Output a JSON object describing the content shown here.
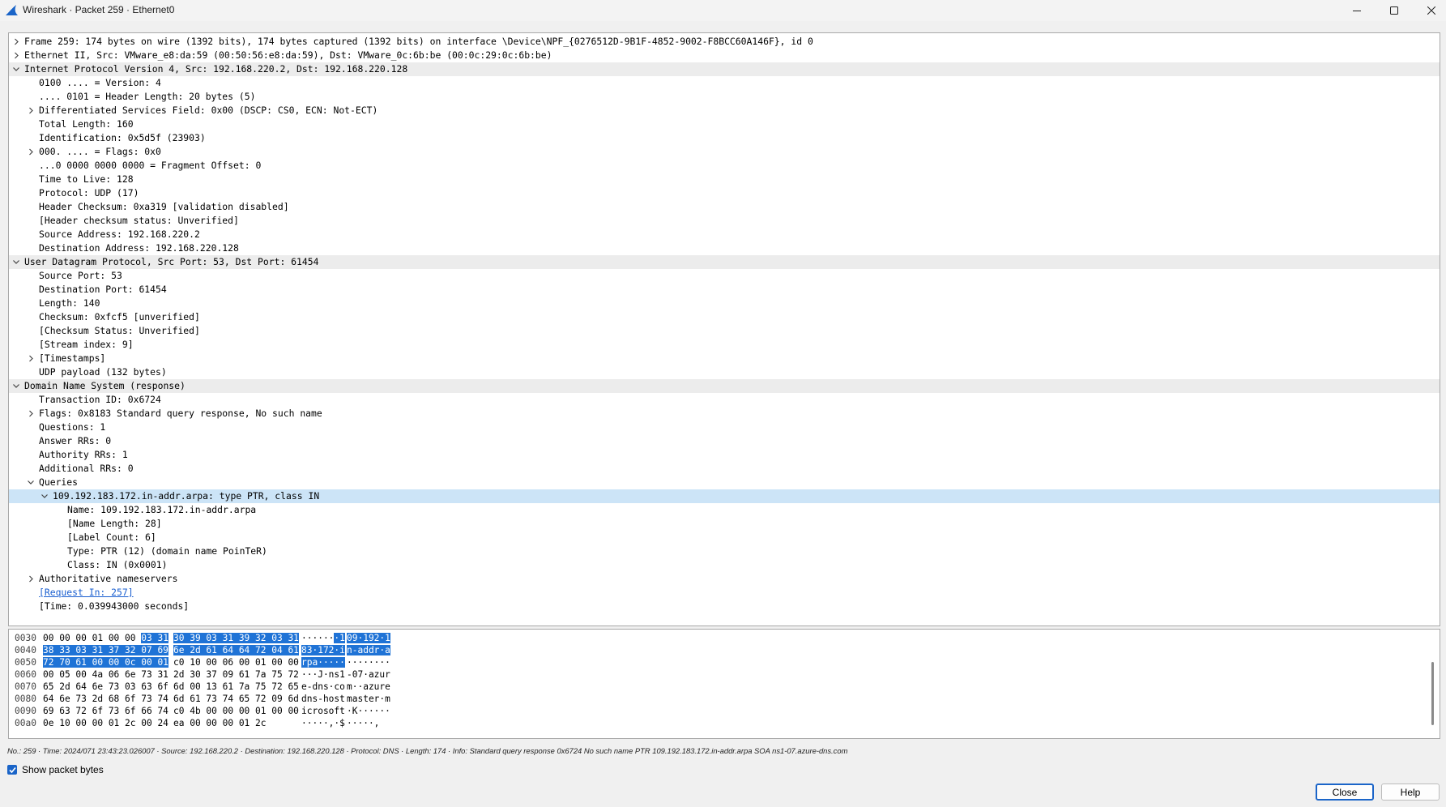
{
  "window": {
    "title": "Wireshark · Packet 259 · Ethernet0",
    "icon": "wireshark-fin-icon",
    "controls": [
      "minimize-icon",
      "maximize-icon",
      "close-icon"
    ]
  },
  "tree": [
    {
      "text": "Frame 259: 174 bytes on wire (1392 bits), 174 bytes captured (1392 bits) on interface \\Device\\NPF_{0276512D-9B1F-4852-9002-F8BCC60A146F}, id 0",
      "level": 0,
      "toggle": "collapsed"
    },
    {
      "text": "Ethernet II, Src: VMware_e8:da:59 (00:50:56:e8:da:59), Dst: VMware_0c:6b:be (00:0c:29:0c:6b:be)",
      "level": 0,
      "toggle": "collapsed"
    },
    {
      "text": "Internet Protocol Version 4, Src: 192.168.220.2, Dst: 192.168.220.128",
      "level": 0,
      "toggle": "expanded",
      "highlight": "gray"
    },
    {
      "text": "0100 .... = Version: 4",
      "level": 1
    },
    {
      "text": ".... 0101 = Header Length: 20 bytes (5)",
      "level": 1
    },
    {
      "text": "Differentiated Services Field: 0x00 (DSCP: CS0, ECN: Not-ECT)",
      "level": 1,
      "toggle": "collapsed"
    },
    {
      "text": "Total Length: 160",
      "level": 1
    },
    {
      "text": "Identification: 0x5d5f (23903)",
      "level": 1
    },
    {
      "text": "000. .... = Flags: 0x0",
      "level": 1,
      "toggle": "collapsed"
    },
    {
      "text": "...0 0000 0000 0000 = Fragment Offset: 0",
      "level": 1
    },
    {
      "text": "Time to Live: 128",
      "level": 1
    },
    {
      "text": "Protocol: UDP (17)",
      "level": 1
    },
    {
      "text": "Header Checksum: 0xa319 [validation disabled]",
      "level": 1
    },
    {
      "text": "[Header checksum status: Unverified]",
      "level": 1
    },
    {
      "text": "Source Address: 192.168.220.2",
      "level": 1
    },
    {
      "text": "Destination Address: 192.168.220.128",
      "level": 1
    },
    {
      "text": "User Datagram Protocol, Src Port: 53, Dst Port: 61454",
      "level": 0,
      "toggle": "expanded",
      "highlight": "gray"
    },
    {
      "text": "Source Port: 53",
      "level": 1
    },
    {
      "text": "Destination Port: 61454",
      "level": 1
    },
    {
      "text": "Length: 140",
      "level": 1
    },
    {
      "text": "Checksum: 0xfcf5 [unverified]",
      "level": 1
    },
    {
      "text": "[Checksum Status: Unverified]",
      "level": 1
    },
    {
      "text": "[Stream index: 9]",
      "level": 1
    },
    {
      "text": "[Timestamps]",
      "level": 1,
      "toggle": "collapsed"
    },
    {
      "text": "UDP payload (132 bytes)",
      "level": 1
    },
    {
      "text": "Domain Name System (response)",
      "level": 0,
      "toggle": "expanded",
      "highlight": "gray"
    },
    {
      "text": "Transaction ID: 0x6724",
      "level": 1
    },
    {
      "text": "Flags: 0x8183 Standard query response, No such name",
      "level": 1,
      "toggle": "collapsed"
    },
    {
      "text": "Questions: 1",
      "level": 1
    },
    {
      "text": "Answer RRs: 0",
      "level": 1
    },
    {
      "text": "Authority RRs: 1",
      "level": 1
    },
    {
      "text": "Additional RRs: 0",
      "level": 1
    },
    {
      "text": "Queries",
      "level": 1,
      "toggle": "expanded"
    },
    {
      "text": "109.192.183.172.in-addr.arpa: type PTR, class IN",
      "level": 2,
      "toggle": "expanded",
      "highlight": "blue"
    },
    {
      "text": "Name: 109.192.183.172.in-addr.arpa",
      "level": 3
    },
    {
      "text": "[Name Length: 28]",
      "level": 3
    },
    {
      "text": "[Label Count: 6]",
      "level": 3
    },
    {
      "text": "Type: PTR (12) (domain name PoinTeR)",
      "level": 3
    },
    {
      "text": "Class: IN (0x0001)",
      "level": 3
    },
    {
      "text": "Authoritative nameservers",
      "level": 1,
      "toggle": "collapsed"
    },
    {
      "text": "[Request In: 257]",
      "level": 1,
      "link": true
    },
    {
      "text": "[Time: 0.039943000 seconds]",
      "level": 1
    }
  ],
  "bytes": [
    {
      "offset": "0030",
      "hex1": [
        {
          "t": "00 00 00 01 00 00 ",
          "s": false
        },
        {
          "t": "03 31",
          "s": true
        }
      ],
      "hex2": [
        {
          "t": "30 39 03 31 39 32 03 31",
          "s": true
        }
      ],
      "ascii1": [
        {
          "t": "······",
          "s": false
        },
        {
          "t": "·1",
          "s": true
        }
      ],
      "ascii2": [
        {
          "t": "09·192·1",
          "s": true
        }
      ]
    },
    {
      "offset": "0040",
      "hex1": [
        {
          "t": "38 33 03 31 37 32 07 69",
          "s": true
        }
      ],
      "hex2": [
        {
          "t": "6e 2d 61 64 64 72 04 61",
          "s": true
        }
      ],
      "ascii1": [
        {
          "t": "83·172·i",
          "s": true
        }
      ],
      "ascii2": [
        {
          "t": "n-addr·a",
          "s": true
        }
      ]
    },
    {
      "offset": "0050",
      "hex1": [
        {
          "t": "72 70 61 00 00 0c 00 01",
          "s": true
        }
      ],
      "hex2": [
        {
          "t": "c0 10 00 06 00 01 00 00",
          "s": false
        }
      ],
      "ascii1": [
        {
          "t": "rpa·····",
          "s": true
        }
      ],
      "ascii2": [
        {
          "t": "········",
          "s": false
        }
      ]
    },
    {
      "offset": "0060",
      "hex1": [
        {
          "t": "00 05 00 4a 06 6e 73 31",
          "s": false
        }
      ],
      "hex2": [
        {
          "t": "2d 30 37 09 61 7a 75 72",
          "s": false
        }
      ],
      "ascii1": [
        {
          "t": "···J·ns1",
          "s": false
        }
      ],
      "ascii2": [
        {
          "t": "-07·azur",
          "s": false
        }
      ]
    },
    {
      "offset": "0070",
      "hex1": [
        {
          "t": "65 2d 64 6e 73 03 63 6f",
          "s": false
        }
      ],
      "hex2": [
        {
          "t": "6d 00 13 61 7a 75 72 65",
          "s": false
        }
      ],
      "ascii1": [
        {
          "t": "e-dns·co",
          "s": false
        }
      ],
      "ascii2": [
        {
          "t": "m··azure",
          "s": false
        }
      ]
    },
    {
      "offset": "0080",
      "hex1": [
        {
          "t": "64 6e 73 2d 68 6f 73 74",
          "s": false
        }
      ],
      "hex2": [
        {
          "t": "6d 61 73 74 65 72 09 6d",
          "s": false
        }
      ],
      "ascii1": [
        {
          "t": "dns-host",
          "s": false
        }
      ],
      "ascii2": [
        {
          "t": "master·m",
          "s": false
        }
      ]
    },
    {
      "offset": "0090",
      "hex1": [
        {
          "t": "69 63 72 6f 73 6f 66 74",
          "s": false
        }
      ],
      "hex2": [
        {
          "t": "c0 4b 00 00 00 01 00 00",
          "s": false
        }
      ],
      "ascii1": [
        {
          "t": "icrosoft",
          "s": false
        }
      ],
      "ascii2": [
        {
          "t": "·K······",
          "s": false
        }
      ]
    },
    {
      "offset": "00a0",
      "hex1": [
        {
          "t": "0e 10 00 00 01 2c 00 24",
          "s": false
        }
      ],
      "hex2": [
        {
          "t": "ea 00 00 00 01 2c",
          "s": false
        }
      ],
      "ascii1": [
        {
          "t": "·····,·$",
          "s": false
        }
      ],
      "ascii2": [
        {
          "t": "·····,",
          "s": false
        }
      ]
    }
  ],
  "status": {
    "line": "No.: 259 · Time: 2024/071 23:43:23.026007 · Source: 192.168.220.2 · Destination: 192.168.220.128 · Protocol: DNS · Length: 174 · Info: Standard query response 0x6724 No such name PTR 109.192.183.172.in-addr.arpa SOA ns1-07.azure-dns.com",
    "show_bytes_label": "Show packet bytes",
    "show_bytes_checked": true
  },
  "buttons": {
    "close_label": "Close",
    "help_label": "Help"
  },
  "colors": {
    "selection": "#1f73d6",
    "row_highlight_blue": "#cce4f7",
    "row_highlight_gray": "#ececec",
    "link": "#1a5fd0"
  }
}
